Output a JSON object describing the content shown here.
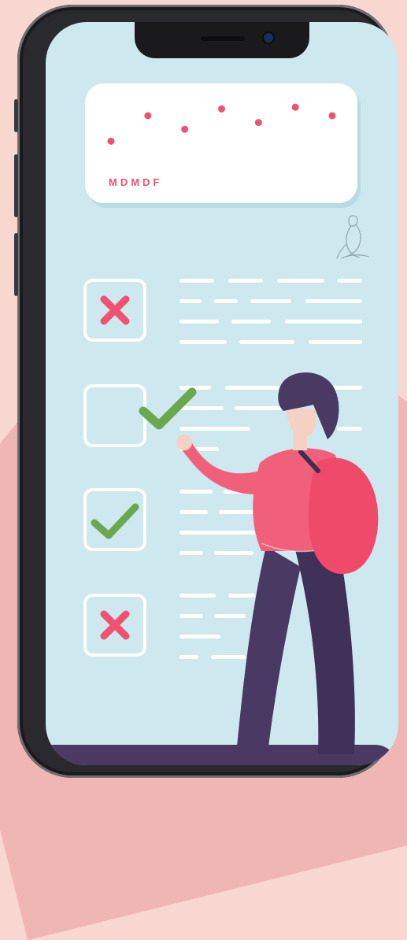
{
  "card": {
    "label": "MDMDF",
    "dot_color": "#f0516f",
    "points": [
      38,
      68,
      52,
      76,
      60,
      78,
      68
    ]
  },
  "checklist": {
    "items": [
      {
        "state": "cross"
      },
      {
        "state": "empty"
      },
      {
        "state": "check"
      },
      {
        "state": "cross"
      }
    ]
  },
  "colors": {
    "background": "#f8d7d0",
    "screen": "#cde8ef",
    "cross": "#f0516f",
    "check": "#6aa84f",
    "figure_top": "#f0607a",
    "figure_pants": "#4a3a63"
  },
  "icons": {
    "logo": "line-art-woman-icon"
  }
}
